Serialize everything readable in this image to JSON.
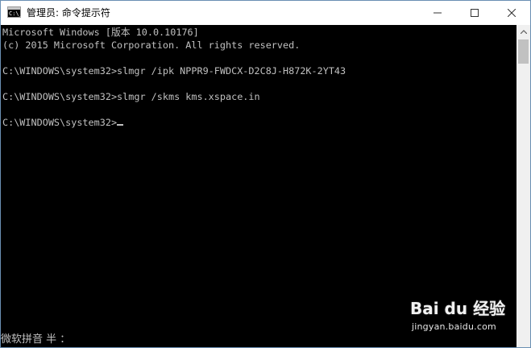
{
  "window": {
    "title": "管理员: 命令提示符",
    "app_icon_text": "C:\\_",
    "controls": {
      "minimize": "minimize-icon",
      "maximize": "maximize-icon",
      "close": "close-icon"
    }
  },
  "console": {
    "lines": [
      "Microsoft Windows [版本 10.0.10176]",
      "(c) 2015 Microsoft Corporation. All rights reserved.",
      "",
      "C:\\WINDOWS\\system32>slmgr /ipk NPPR9-FWDCX-D2C8J-H872K-2YT43",
      "",
      "C:\\WINDOWS\\system32>slmgr /skms kms.xspace.in",
      "",
      "C:\\WINDOWS\\system32>"
    ],
    "foreground": "#c0c0c0",
    "background": "#000000"
  },
  "ime": {
    "status": "微软拼音 半 ："
  },
  "watermark": {
    "logo": "Bai du 经验",
    "url": "jingyan.baidu.com"
  }
}
